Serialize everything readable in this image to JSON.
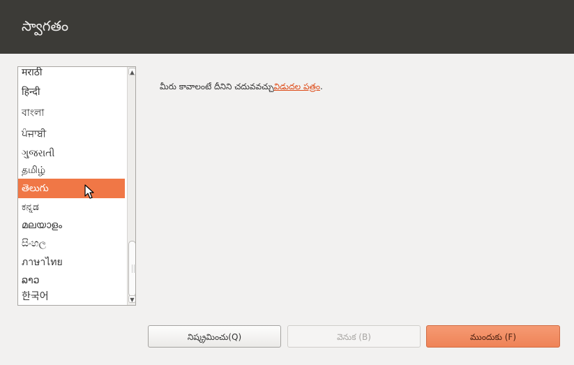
{
  "header": {
    "title": "స్వాగతం"
  },
  "languages": {
    "items": [
      "मराठी",
      "हिन्दी",
      "বাংলা",
      "ਪੰਜਾਬੀ",
      "ગુજરાતી",
      "தமிழ்",
      "తెలుగు",
      "ಕನ್ನಡ",
      "മലയാളം",
      "සිංහල",
      "ภาษาไทย",
      "ລາວ",
      "한국어"
    ],
    "selected": "తెలుగు"
  },
  "scrollbar": {
    "up_arrow": "▲",
    "down_arrow": "▼"
  },
  "release_note": {
    "text": "మీరు కావాలంటే దీనిని చదువవచ్చు",
    "link": "విడుదల పత్రం",
    "suffix": "."
  },
  "buttons": {
    "quit": "నిష్క్రమించు(Q)",
    "back": "వెనుక (B)",
    "forward": "ముందుకు (F)"
  },
  "colors": {
    "accent": "#f07746",
    "header_bg": "#3c3b37",
    "link": "#dd4814"
  }
}
